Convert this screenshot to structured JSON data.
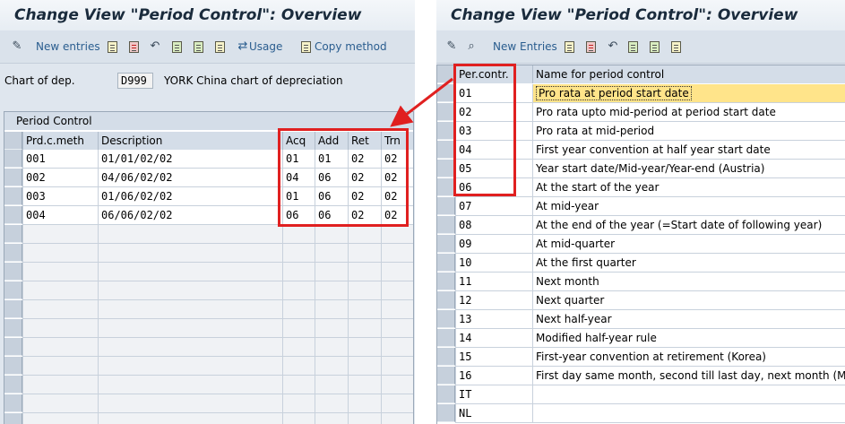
{
  "left": {
    "title": "Change View \"Period Control\": Overview",
    "toolbar": {
      "new_entries": "New entries",
      "usage": "Usage",
      "copy_method": "Copy method"
    },
    "chart_of_dep": {
      "label": "Chart of dep.",
      "value": "D999",
      "description": "YORK China chart of depreciation"
    },
    "table": {
      "title": "Period Control",
      "columns": [
        "Prd.c.meth",
        "Description",
        "Acq",
        "Add",
        "Ret",
        "Trn"
      ],
      "rows": [
        [
          "001",
          "01/01/02/02",
          "01",
          "01",
          "02",
          "02"
        ],
        [
          "002",
          "04/06/02/02",
          "04",
          "06",
          "02",
          "02"
        ],
        [
          "003",
          "01/06/02/02",
          "01",
          "06",
          "02",
          "02"
        ],
        [
          "004",
          "06/06/02/02",
          "06",
          "06",
          "02",
          "02"
        ]
      ]
    }
  },
  "right": {
    "title": "Change View \"Period Control\": Overview",
    "toolbar": {
      "new_entries": "New Entries"
    },
    "table": {
      "columns": [
        "Per.contr.",
        "Name for period control"
      ],
      "rows": [
        [
          "01",
          "Pro rata at period start date"
        ],
        [
          "02",
          "Pro rata upto mid-period at period start date"
        ],
        [
          "03",
          "Pro rata at mid-period"
        ],
        [
          "04",
          "First year convention at half year start date"
        ],
        [
          "05",
          "Year start date/Mid-year/Year-end (Austria)"
        ],
        [
          "06",
          "At the start of the year"
        ],
        [
          "07",
          "At mid-year"
        ],
        [
          "08",
          "At the end of the year (=Start date of following year)"
        ],
        [
          "09",
          "At mid-quarter"
        ],
        [
          "10",
          "At the first quarter"
        ],
        [
          "11",
          "Next month"
        ],
        [
          "12",
          "Next quarter"
        ],
        [
          "13",
          "Next half-year"
        ],
        [
          "14",
          "Modified half-year rule"
        ],
        [
          "15",
          "First-year convention at retirement (Korea)"
        ],
        [
          "16",
          "First day same month, second till last day, next month  (MX)"
        ],
        [
          "IT",
          ""
        ],
        [
          "NL",
          ""
        ]
      ]
    }
  },
  "colors": {
    "highlight_box": "#e02020",
    "selected_cell": "#ffe48a"
  }
}
